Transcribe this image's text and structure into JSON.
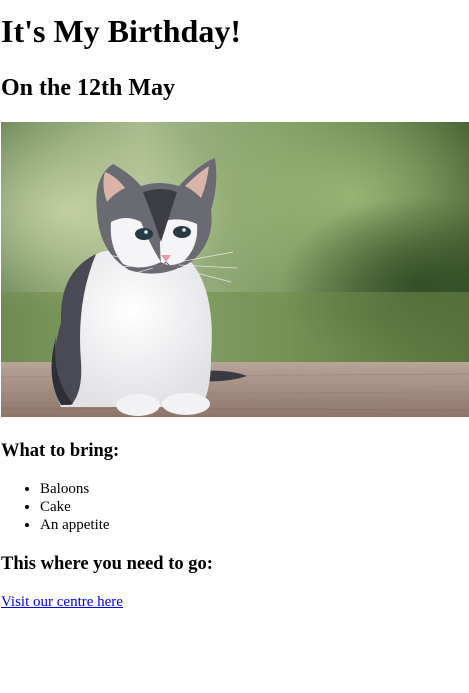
{
  "title": "It's My Birthday!",
  "date_heading": "On the 12th May",
  "image": {
    "subject": "kitten-photo"
  },
  "bring": {
    "heading": "What to bring:",
    "items": [
      "Baloons",
      "Cake",
      "An appetite"
    ]
  },
  "location": {
    "heading": "This where you need to go:",
    "link_text": "Visit our centre here"
  },
  "colors": {
    "link": "#0000ee",
    "text": "#000000",
    "background": "#ffffff"
  }
}
